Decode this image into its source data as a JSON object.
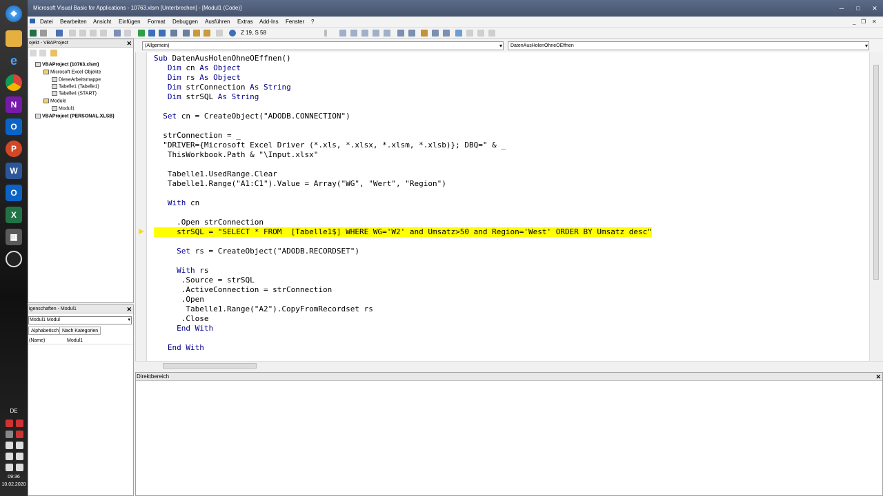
{
  "window": {
    "title": "Microsoft Visual Basic for Applications - 10763.xlsm [Unterbrechen] - [Modul1 (Code)]"
  },
  "menubar": {
    "items": [
      "Datei",
      "Bearbeiten",
      "Ansicht",
      "Einfügen",
      "Format",
      "Debuggen",
      "Ausführen",
      "Extras",
      "Add-Ins",
      "Fenster",
      "?"
    ]
  },
  "toolbar": {
    "cursor_position": "Z 19, S 58"
  },
  "project_explorer": {
    "title": "ojekt - VBAProject",
    "items": [
      "VBAProject (10763.xlsm)",
      "Microsoft Excel Objekte",
      "DieseArbeitsmappe",
      "Tabelle1 (Tabelle1)",
      "Tabelle4 (START)",
      "Module",
      "Modul1",
      "VBAProject (PERSONAL.XLSB)"
    ]
  },
  "properties": {
    "title": "igenschaften - Modul1",
    "object": "Modul1 Modul",
    "tabs": [
      "Alphabetisch",
      "Nach Kategorien"
    ],
    "name_key": "(Name)",
    "name_value": "Modul1"
  },
  "code_window": {
    "object_combo": "(Allgemein)",
    "proc_combo": "DatenAusHolenOhneOEffnen",
    "lines": [
      "Sub DatenAusHolenOhneOEffnen()",
      "   Dim cn As Object",
      "   Dim rs As Object",
      "   Dim strConnection As String",
      "   Dim strSQL As String",
      "",
      "  Set cn = CreateObject(\"ADODB.CONNECTION\")",
      "",
      "  strConnection = _",
      "  \"DRIVER={Microsoft Excel Driver (*.xls, *.xlsx, *.xlsm, *.xlsb)}; DBQ=\" & _",
      "   ThisWorkbook.Path & \"\\Input.xlsx\"",
      "",
      "   Tabelle1.UsedRange.Clear",
      "   Tabelle1.Range(\"A1:C1\").Value = Array(\"WG\", \"Wert\", \"Region\")",
      "",
      "   With cn",
      "",
      "     .Open strConnection",
      "     strSQL = \"SELECT * FROM  [Tabelle1$] WHERE WG='W2' and Umsatz>50 and Region='West' ORDER BY Umsatz desc\"",
      "",
      "     Set rs = CreateObject(\"ADODB.RECORDSET\")",
      "",
      "     With rs",
      "      .Source = strSQL",
      "      .ActiveConnection = strConnection",
      "      .Open",
      "       Tabelle1.Range(\"A2\").CopyFromRecordset rs",
      "      .Close",
      "     End With",
      "",
      "   End With"
    ],
    "highlighted_line": 18
  },
  "immediate": {
    "title": "Direktbereich"
  },
  "taskbar": {
    "language": "DE",
    "time": "09:36",
    "date": "10.02.2020"
  }
}
